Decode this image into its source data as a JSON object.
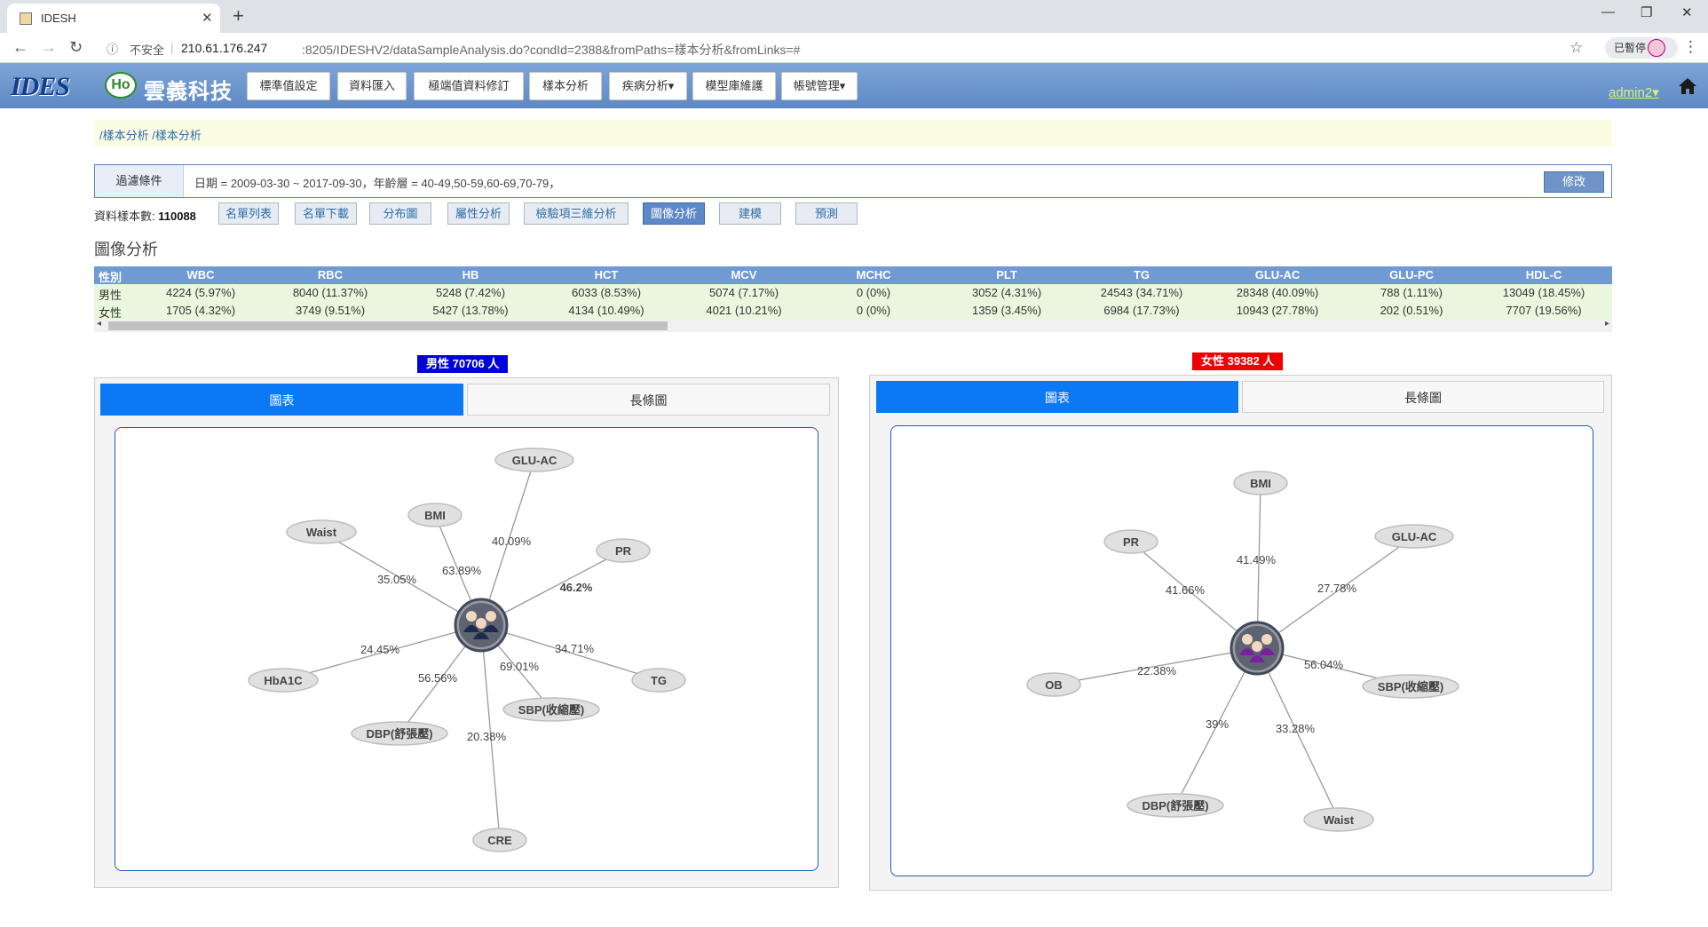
{
  "browser": {
    "tab_title": "IDESH",
    "insecure_label": "不安全",
    "url_host": "210.61.176.247",
    "url_path": ":8205/IDESHV2/dataSampleAnalysis.do?condId=2388&fromPaths=樣本分析&fromLinks=#",
    "paused_label": "已暫停"
  },
  "header": {
    "logo_text": "IDES",
    "logo_mark": "Ho",
    "company_name": "雲義科技",
    "menu": [
      "標準值設定",
      "資料匯入",
      "極端值資料修訂",
      "樣本分析",
      "疾病分析▾",
      "模型庫維護",
      "帳號管理▾"
    ],
    "user": "admin2▾"
  },
  "breadcrumb": "/樣本分析 /樣本分析",
  "filter": {
    "label": "過濾條件",
    "text": "日期 = 2009-03-30 ~ 2017-09-30，年齡層 = 40-49,50-59,60-69,70-79，",
    "edit_label": "修改"
  },
  "sample": {
    "label": "資料樣本數:",
    "count": "110088"
  },
  "actions": [
    "名單列表",
    "名單下載",
    "分布圖",
    "屬性分析",
    "檢驗項三維分析",
    "圖像分析",
    "建模",
    "預測"
  ],
  "section_title": "圖像分析",
  "table": {
    "headers": [
      "性別",
      "WBC",
      "RBC",
      "HB",
      "HCT",
      "MCV",
      "MCHC",
      "PLT",
      "TG",
      "GLU-AC",
      "GLU-PC",
      "HDL-C"
    ],
    "rows": [
      [
        "男性",
        "4224 (5.97%)",
        "8040 (11.37%)",
        "5248 (7.42%)",
        "6033 (8.53%)",
        "5074 (7.17%)",
        "0 (0%)",
        "3052 (4.31%)",
        "24543 (34.71%)",
        "28348 (40.09%)",
        "788 (1.11%)",
        "13049 (18.45%)"
      ],
      [
        "女性",
        "1705 (4.32%)",
        "3749 (9.51%)",
        "5427 (13.78%)",
        "4134 (10.49%)",
        "4021 (10.21%)",
        "0 (0%)",
        "1359 (3.45%)",
        "6984 (17.73%)",
        "10943 (27.78%)",
        "202 (0.51%)",
        "7707 (19.56%)"
      ]
    ]
  },
  "panels": {
    "male": {
      "badge": "男性 70706 人",
      "badge_color": "#0000dd",
      "tabs": [
        "圖表",
        "長條圖"
      ],
      "nodes": [
        {
          "label": "GLU-AC",
          "pct": "40.09%"
        },
        {
          "label": "BMI",
          "pct": "63.89%"
        },
        {
          "label": "Waist",
          "pct": "35.05%"
        },
        {
          "label": "PR",
          "pct": "46.2%"
        },
        {
          "label": "TG",
          "pct": "34.71%"
        },
        {
          "label": "SBP(收縮壓)",
          "pct": "69.01%"
        },
        {
          "label": "CRE",
          "pct": "20.38%"
        },
        {
          "label": "DBP(舒張壓)",
          "pct": "56.56%"
        },
        {
          "label": "HbA1C",
          "pct": "24.45%"
        }
      ]
    },
    "female": {
      "badge": "女性 39382 人",
      "badge_color": "#ee0000",
      "tabs": [
        "圖表",
        "長條圖"
      ],
      "nodes": [
        {
          "label": "BMI",
          "pct": "41.49%"
        },
        {
          "label": "PR",
          "pct": "41.66%"
        },
        {
          "label": "GLU-AC",
          "pct": "27.78%"
        },
        {
          "label": "OB",
          "pct": "22.38%"
        },
        {
          "label": "SBP(收縮壓)",
          "pct": "56.04%"
        },
        {
          "label": "Waist",
          "pct": "33.28%"
        },
        {
          "label": "DBP(舒張壓)",
          "pct": "39%"
        }
      ]
    }
  }
}
